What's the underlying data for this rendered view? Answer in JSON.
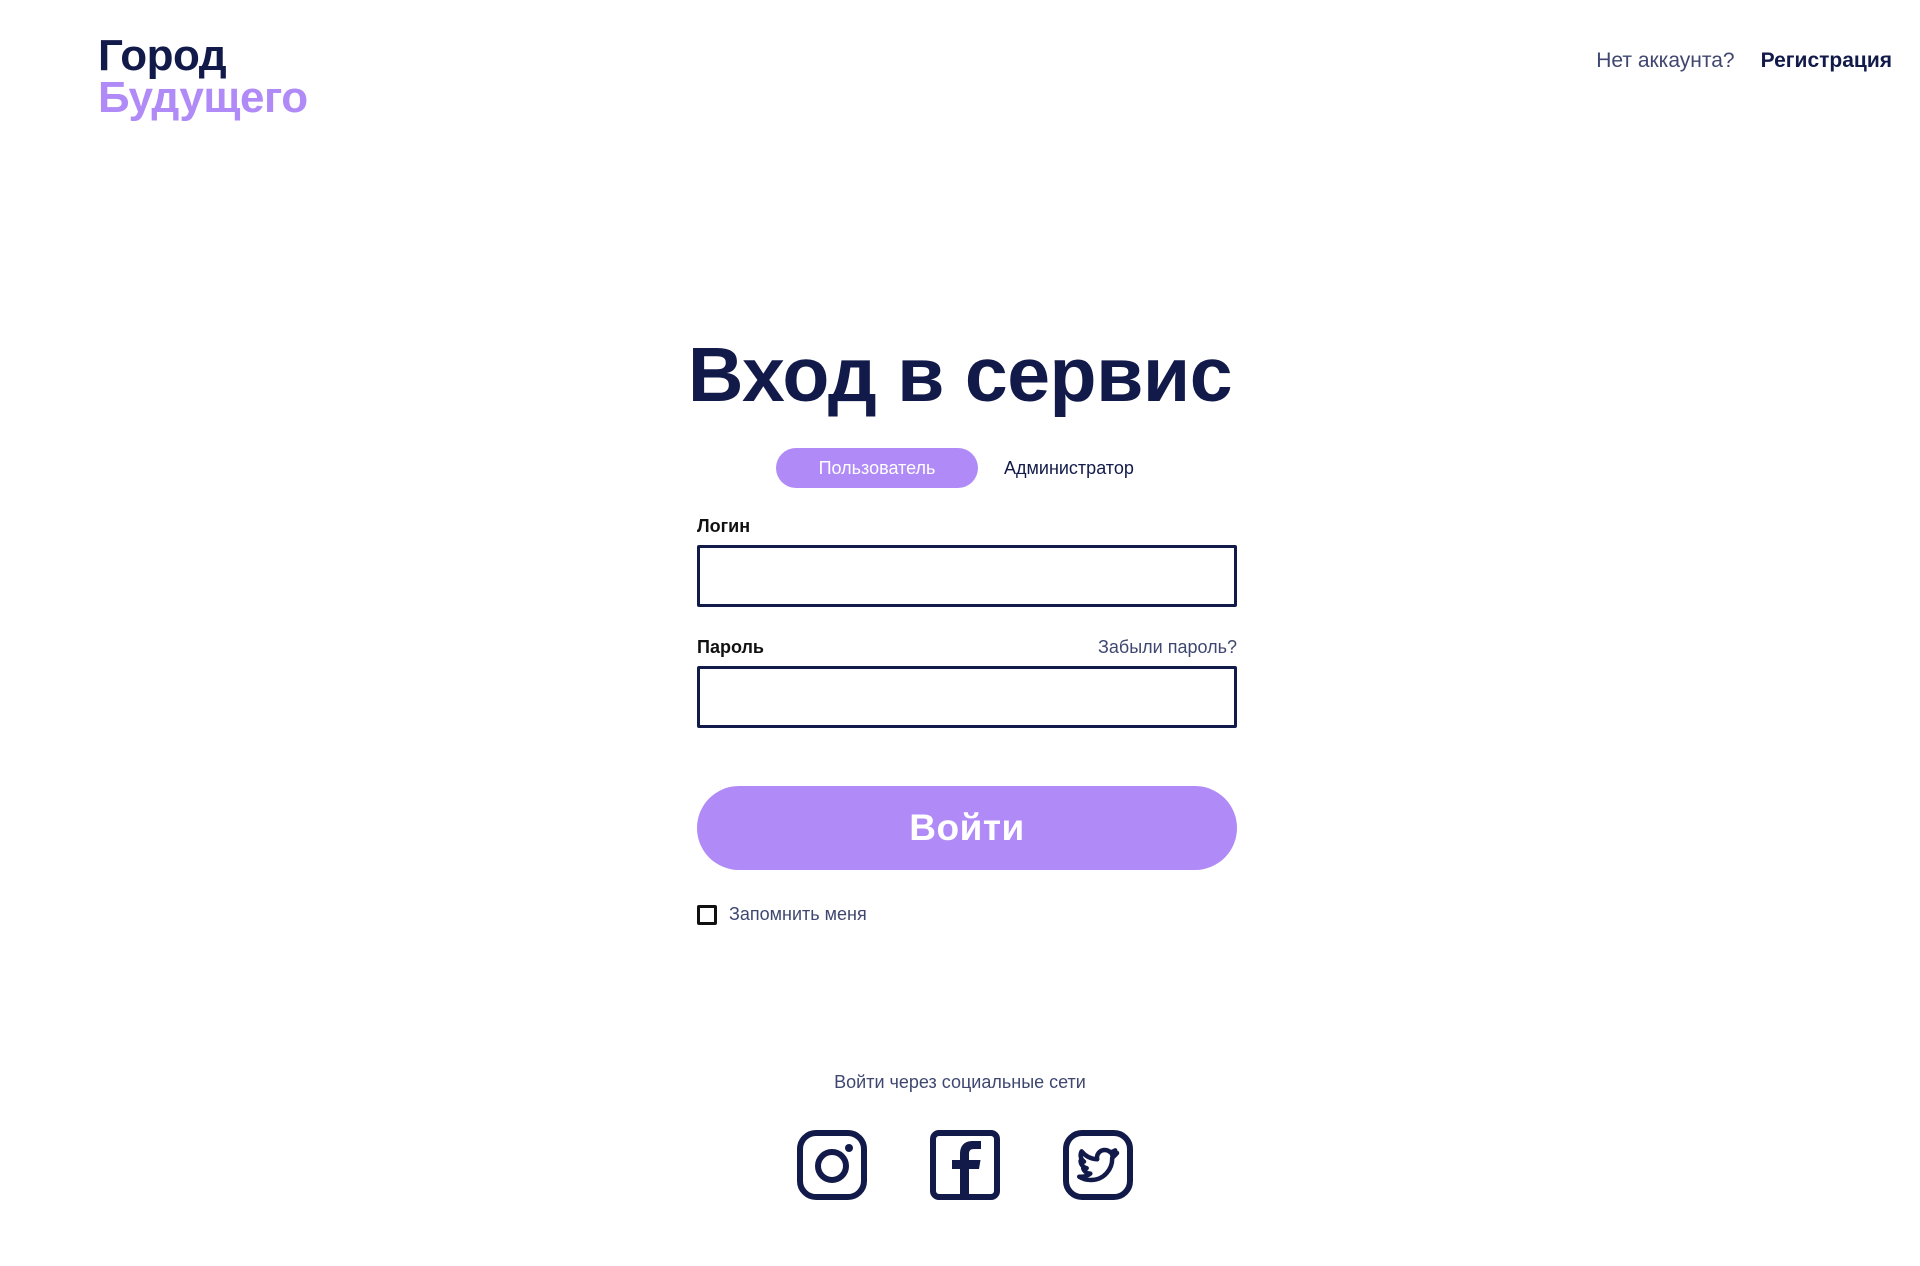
{
  "brand": {
    "line1": "Город",
    "line2": "Будущего",
    "primary_color": "#121a4a",
    "accent_color": "#b08af7"
  },
  "topnav": {
    "question": "Нет аккаунта?",
    "register_label": "Регистрация"
  },
  "login": {
    "title": "Вход в сервис",
    "tabs": [
      {
        "label": "Пользователь",
        "active": true
      },
      {
        "label": "Администратор",
        "active": false
      }
    ],
    "username_label": "Логин",
    "username_value": "",
    "password_label": "Пароль",
    "password_value": "",
    "forgot_label": "Забыли пароль?",
    "submit_label": "Войти",
    "remember_label": "Запомнить меня",
    "remember_checked": false
  },
  "social": {
    "caption": "Войти через социальные сети",
    "buttons": [
      {
        "name": "instagram",
        "icon": "instagram-icon"
      },
      {
        "name": "facebook",
        "icon": "facebook-icon"
      },
      {
        "name": "twitter",
        "icon": "twitter-icon"
      }
    ]
  }
}
